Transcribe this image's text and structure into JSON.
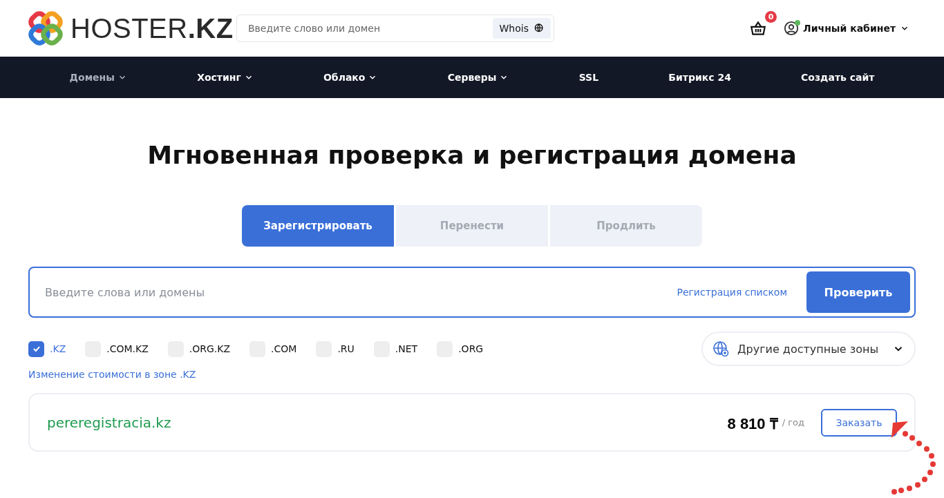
{
  "header": {
    "logo_text": "HOSTER",
    "logo_suffix": ".KZ",
    "search": {
      "placeholder": "Введите слово или домен",
      "button": "Whois"
    },
    "cart_count": "0",
    "account": {
      "label": "Личный кабинет",
      "online": true
    }
  },
  "nav": [
    {
      "label": "Домены",
      "dropdown": true,
      "selected": true
    },
    {
      "label": "Хостинг",
      "dropdown": true,
      "selected": false
    },
    {
      "label": "Облако",
      "dropdown": true,
      "selected": false
    },
    {
      "label": "Серверы",
      "dropdown": true,
      "selected": false
    },
    {
      "label": "SSL",
      "dropdown": false,
      "selected": false
    },
    {
      "label": "Битрикс 24",
      "dropdown": false,
      "selected": false
    },
    {
      "label": "Создать сайт",
      "dropdown": false,
      "selected": false
    }
  ],
  "title": "Мгновенная проверка и регистрация домена",
  "tabs": [
    {
      "label": "Зарегистрировать",
      "selected": true
    },
    {
      "label": "Перенести",
      "selected": false
    },
    {
      "label": "Продлить",
      "selected": false
    }
  ],
  "domain_search": {
    "placeholder": "Введите слова или домены",
    "list_link": "Регистрация списком",
    "button": "Проверить"
  },
  "zones": [
    {
      "label": ".KZ",
      "checked": true
    },
    {
      "label": ".COM.KZ",
      "checked": false
    },
    {
      "label": ".ORG.KZ",
      "checked": false
    },
    {
      "label": ".COM",
      "checked": false
    },
    {
      "label": ".RU",
      "checked": false
    },
    {
      "label": ".NET",
      "checked": false
    },
    {
      "label": ".ORG",
      "checked": false
    }
  ],
  "other_zones": "Другие доступные зоны",
  "price_change_link": "Изменение стоимости в зоне .KZ",
  "result": {
    "domain": "pereregistracia.kz",
    "price": "8 810 ₸",
    "period": "/ год",
    "button": "Заказать"
  }
}
